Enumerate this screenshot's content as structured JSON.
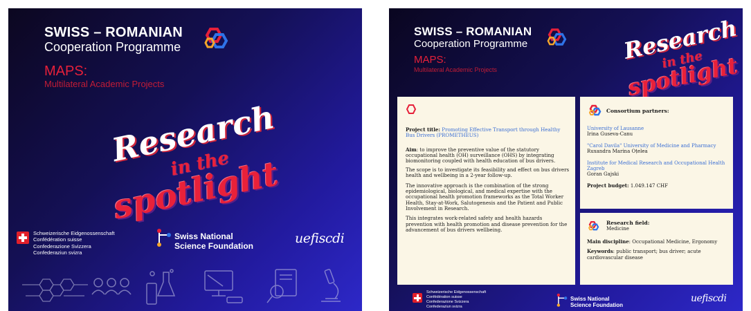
{
  "left": {
    "title": "SWISS – ROMANIAN",
    "subtitle": "Cooperation Programme",
    "maps_title": "MAPS:",
    "maps_subtitle": "Multilateral Academic Projects",
    "script_line1": "Research",
    "script_line2": "in the",
    "script_line3": "spotlight",
    "fed_lines": [
      "Schweizerische Eidgenossenschaft",
      "Confédération suisse",
      "Confederazione Svizzera",
      "Confederaziun svizra"
    ],
    "snsf_line1": "Swiss National",
    "snsf_line2": "Science Foundation",
    "uefiscdi": "uefiscdi"
  },
  "right": {
    "title": "SWISS – ROMANIAN",
    "subtitle": "Cooperation Programme",
    "maps_title": "MAPS:",
    "maps_subtitle": "Multilateral Academic Projects",
    "script_line1": "Research",
    "script_line2": "in the",
    "script_line3": "spotlight",
    "project": {
      "title_label": "Project title:",
      "title_value": "Promoting Effective Transport through Healthy Bus Drivers (PROMETHEUS)",
      "aim_label": "Aim",
      "aim_text": ": to improve the preventive value of the statutory occupational health (OH) surveillance (OHS) by integrating biomonitoring coupled with health education of bus drivers.",
      "scope_text": "The scope is to investigate its feasibility and effect on bus drivers health and wellbeing in a 2-year follow-up.",
      "innovative_text": "The innovative approach is the combination of the strong epidemiological, biological, and medical expertise with the occupational health promotion frameworks as the Total Worker Health, Stay-at-Work, Salutogenesis and the Patient and Public Involvement in Research.",
      "integrates_text": "This integrates work-related safety and health hazards prevention with health promotion and disease prevention for the advancement of bus drivers wellbeing."
    },
    "consortium": {
      "heading": "Consortium partners:",
      "partners": [
        {
          "institution": "University of Lausanne",
          "person": "Irina Guseva-Canu"
        },
        {
          "institution": "\"Carol Davila\" University of Medicine and Pharmacy",
          "person": "Ruxandra Marina Oțelea"
        },
        {
          "institution": "Institute for Medical Research and Occupational Health Zagreb",
          "person": "Goran Gajski"
        }
      ],
      "budget_label": "Project budget:",
      "budget_value": "1.049.147 CHF"
    },
    "research": {
      "heading": "Research field:",
      "field": "Medicine",
      "discipline_label": "Main discipline",
      "discipline_value": ": Occupational Medicine, Ergonomy",
      "keywords_label": "Keywords",
      "keywords_value": ": public transport; bus driver; acute cardiovascular disease"
    },
    "fed_lines": [
      "Schweizerische Eidgenossenschaft",
      "Confédération suisse",
      "Confederazione Svizzera",
      "Confederaziun svizra"
    ],
    "snsf_line1": "Swiss National",
    "snsf_line2": "Science Foundation",
    "uefiscdi": "uefiscdi"
  },
  "colors": {
    "accent_red": "#e6203a",
    "panel_bg": "#fbf6e6",
    "link_blue": "#3b6fd4"
  }
}
